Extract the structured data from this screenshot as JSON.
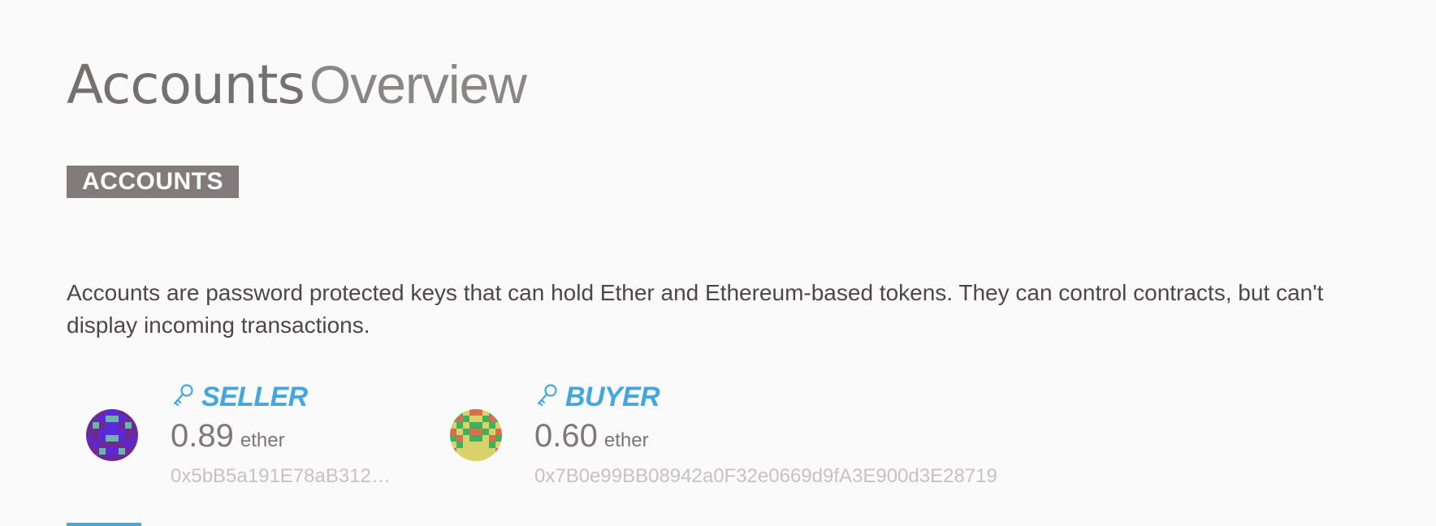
{
  "header": {
    "title_strong": "Accounts",
    "title_light": "Overview"
  },
  "section": {
    "badge": "ACCOUNTS",
    "description": "Accounts are password protected keys that can hold Ether and Ethereum-based tokens. They can control contracts, but can't display incoming transactions."
  },
  "accounts": [
    {
      "name": "SELLER",
      "balance": "0.89",
      "unit": "ether",
      "address": "0x5bB5a191E78aB312…",
      "icon": "key-icon"
    },
    {
      "name": "BUYER",
      "balance": "0.60",
      "unit": "ether",
      "address": "0x7B0e99BB08942a0F32e0669d9fA3E900d3E28719",
      "icon": "key-icon"
    }
  ],
  "colors": {
    "accent": "#42a6df",
    "badge_background": "#827b7c",
    "page_background": "#fafafa",
    "title_text": "#756f70",
    "address_text": "#c7c1c2"
  }
}
